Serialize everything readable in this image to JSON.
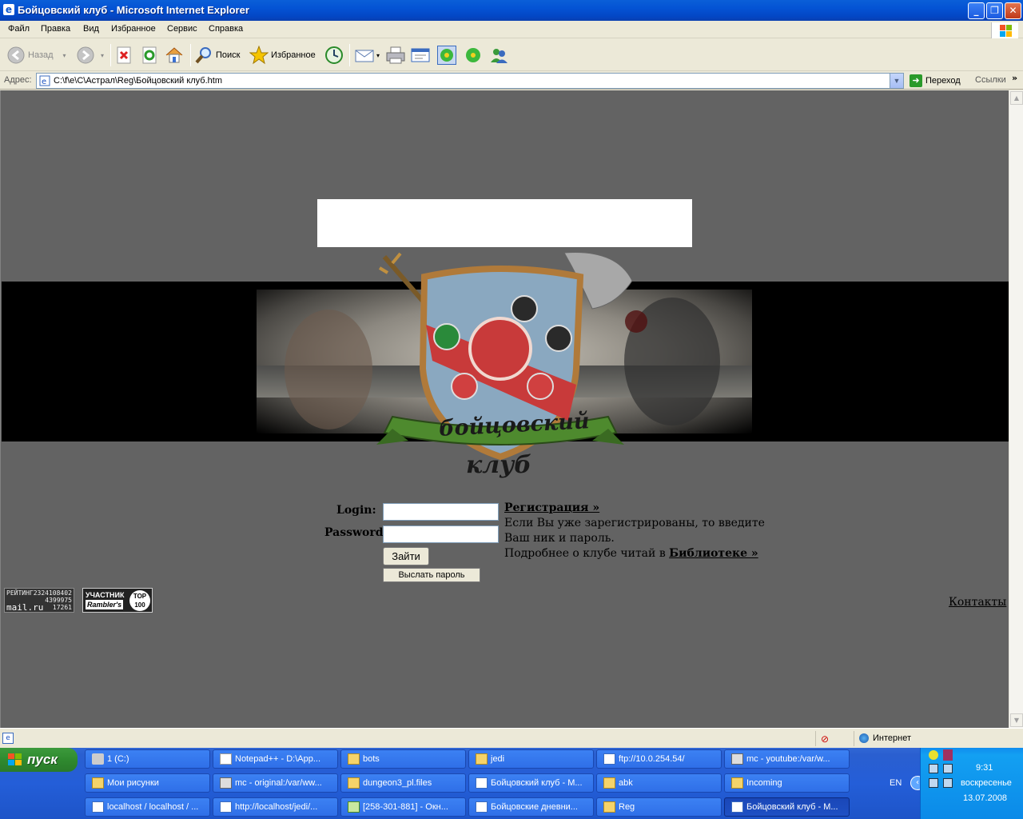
{
  "window": {
    "title": "Бойцовский клуб - Microsoft Internet Explorer"
  },
  "menu": [
    "Файл",
    "Правка",
    "Вид",
    "Избранное",
    "Сервис",
    "Справка"
  ],
  "toolbar": {
    "back": "Назад",
    "search": "Поиск",
    "favorites": "Избранное"
  },
  "address": {
    "label": "Адрес:",
    "value": "C:\\f\\e\\C\\Астрал\\Reg\\Бойцовский клуб.htm",
    "go": "Переход",
    "links": "Ссылки"
  },
  "page": {
    "logo_line1": "бойцовский",
    "logo_line2": "клуб",
    "login_label": "Login:",
    "password_label": "Password:",
    "login_button": "Зайти",
    "send_password_button": "Выслать пароль",
    "register_link": "Регистрация »",
    "info_line1": "Если Вы уже зарегистрированы, то введите",
    "info_line2": "Ваш ник и пароль.",
    "info_line3_prefix": "Подробнее о клубе читай в ",
    "library_link": "Библиотеке »",
    "contacts_link": "Контакты",
    "mailru": {
      "title": "РЕЙТИНГ",
      "code": "2324108402",
      "n1": "4399975",
      "n2": "17261",
      "brand": "mail.ru"
    },
    "rambler": {
      "line1": "УЧАСТНИК",
      "line2": "Rambler's",
      "top": "TOP",
      "top_num": "100"
    }
  },
  "status": {
    "zone": "Интернет"
  },
  "taskbar": {
    "start": "пуск",
    "row1": [
      "1 (C:)",
      "Notepad++ - D:\\App...",
      "bots",
      "jedi",
      "ftp://10.0.254.54/",
      "mc - youtube:/var/w..."
    ],
    "row2": [
      "Мои рисунки",
      "mc - original:/var/ww...",
      "dungeon3_pl.files",
      "Бойцовский клуб - M...",
      "abk",
      "Incoming"
    ],
    "row3": [
      "localhost / localhost / ...",
      "http://localhost/jedi/...",
      "[258-301-881] - Окн...",
      "Бойцовские дневни...",
      "Reg",
      "Бойцовский клуб - M..."
    ],
    "lang": "EN",
    "time": "9:31",
    "day": "воскресенье",
    "date": "13.07.2008"
  }
}
